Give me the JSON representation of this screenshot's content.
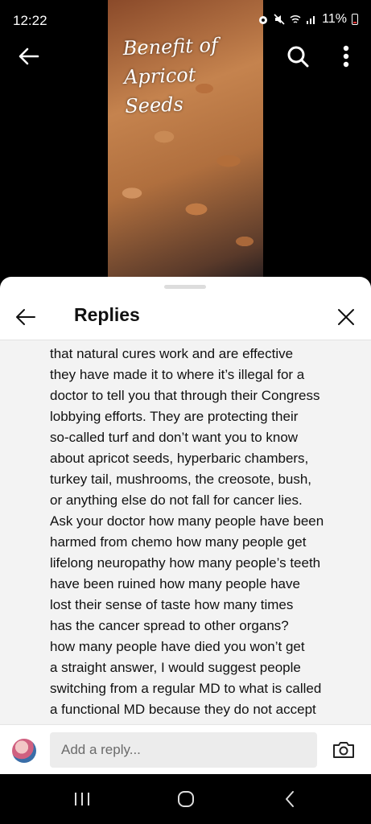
{
  "status_bar": {
    "time": "12:22",
    "battery": "11%"
  },
  "video": {
    "caption_lines": [
      "Benefit of",
      "Apricot",
      "Seeds"
    ]
  },
  "sheet": {
    "title": "Replies",
    "reply_lines": [
      "that natural cures work and are effective",
      "they have made it to where it’s illegal for a",
      "doctor to tell you that through  their Congress",
      "lobbying efforts. They are protecting their",
      "so-called turf and don’t want you to know",
      "about apricot seeds, hyperbaric chambers,",
      "turkey tail, mushrooms, the creosote, bush,",
      "or anything else do not fall for cancer lies.",
      "Ask your doctor how many people have been",
      "harmed from chemo how many people get",
      "lifelong neuropathy how many people’s teeth",
      "have been ruined how many people have",
      "lost their sense of taste how many times",
      "has the cancer spread to other organs?",
      "how many people have died you won’t get",
      "a straight answer, I would suggest people",
      "switching from a regular MD to what is called",
      "a functional MD because they do not accept"
    ],
    "input_placeholder": "Add a reply..."
  },
  "colors": {
    "sheet_bg": "#ffffff",
    "reply_bg": "#f3f3f3",
    "input_bg": "#ececec"
  }
}
